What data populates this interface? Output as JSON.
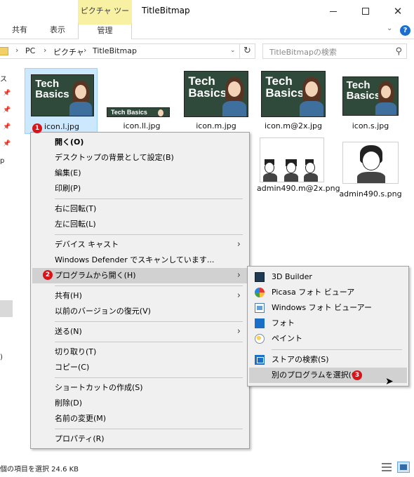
{
  "window": {
    "title": "TitleBitmap",
    "context_tab_group": "ピクチャ ツール"
  },
  "ribbon": {
    "tabs": [
      "共有",
      "表示",
      "管理"
    ],
    "help": "?"
  },
  "address": {
    "crumbs": [
      "PC",
      "ピクチャ",
      "TitleBitmap"
    ],
    "search_placeholder": "TitleBitmapの検索"
  },
  "nav": {
    "fragments": [
      "ス",
      "p",
      ")"
    ]
  },
  "files": {
    "thumb_text": "Tech Basics",
    "items": [
      {
        "name": "icon.l.jpg"
      },
      {
        "name": "icon.ll.jpg"
      },
      {
        "name": "icon.m.jpg"
      },
      {
        "name": "icon.m@2x.jpg"
      },
      {
        "name": "icon.s.jpg"
      },
      {
        "name": "admin490.m@2x.png"
      },
      {
        "name": "admin490.s.png"
      }
    ]
  },
  "context_menu": {
    "items": [
      {
        "label": "開く(O)"
      },
      {
        "label": "デスクトップの背景として設定(B)"
      },
      {
        "label": "編集(E)"
      },
      {
        "label": "印刷(P)"
      },
      {
        "label": "右に回転(T)"
      },
      {
        "label": "左に回転(L)"
      },
      {
        "label": "デバイス キャスト"
      },
      {
        "label": "Windows Defender でスキャンしています..."
      },
      {
        "label": "プログラムから開く(H)"
      },
      {
        "label": "共有(H)"
      },
      {
        "label": "以前のバージョンの復元(V)"
      },
      {
        "label": "送る(N)"
      },
      {
        "label": "切り取り(T)"
      },
      {
        "label": "コピー(C)"
      },
      {
        "label": "ショートカットの作成(S)"
      },
      {
        "label": "削除(D)"
      },
      {
        "label": "名前の変更(M)"
      },
      {
        "label": "プロパティ(R)"
      }
    ],
    "submenu_arrow": "›"
  },
  "open_with_menu": {
    "items": [
      {
        "label": "3D Builder",
        "icon": "3d-builder-icon"
      },
      {
        "label": "Picasa フォト ビューア",
        "icon": "picasa-icon"
      },
      {
        "label": "Windows フォト ビューアー",
        "icon": "windows-photo-viewer-icon"
      },
      {
        "label": "フォト",
        "icon": "photos-icon"
      },
      {
        "label": "ペイント",
        "icon": "paint-icon"
      },
      {
        "label": "ストアの検索(S)",
        "icon": "store-icon"
      },
      {
        "label": "別のプログラムを選択(C)"
      }
    ]
  },
  "badges": [
    "1",
    "2",
    "3"
  ],
  "colors": {
    "context_tab": "#f8f0a2",
    "selection": "#cce8ff",
    "badge": "#d8141a",
    "menu_bg": "#f0f0f0",
    "menu_highlight": "#d1d1d1"
  },
  "status": {
    "text": "個の項目を選択 24.6 KB"
  }
}
